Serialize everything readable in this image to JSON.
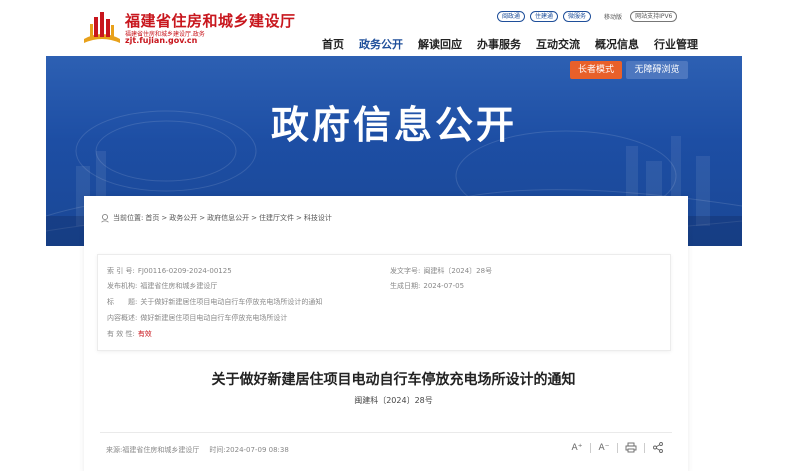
{
  "header": {
    "site_name": "福建省住房和城乡建设厅",
    "site_sub": "福建省住房和城乡建设厅.政务",
    "site_domain": "zjt.fujian.gov.cn",
    "top_links": [
      "闽政通",
      "住建通",
      "微服务"
    ],
    "mobile": "移动版",
    "ipv6": "网站支持IPV6"
  },
  "nav": {
    "items": [
      "首页",
      "政务公开",
      "解读回应",
      "办事服务",
      "互动交流",
      "概况信息",
      "行业管理"
    ],
    "active_index": 1
  },
  "banner": {
    "title": "政府信息公开",
    "elder_mode": "长者模式",
    "accessibility": "无障碍浏览"
  },
  "breadcrumb": {
    "label": "当前位置:",
    "items": [
      "首页",
      "政务公开",
      "政府信息公开",
      "住建厅文件",
      "科技设计"
    ]
  },
  "info": {
    "index_label": "索 引 号:",
    "index_value": "FJ00116-0209-2024-00125",
    "docno_label": "发文字号:",
    "docno_value": "闽建科〔2024〕28号",
    "org_label": "发布机构:",
    "org_value": "福建省住房和城乡建设厅",
    "date_label": "生成日期:",
    "date_value": "2024-07-05",
    "title_label": "标　　题:",
    "title_value": "关于做好新建居住项目电动自行车停放充电场所设计的通知",
    "summary_label": "内容概述:",
    "summary_value": "做好新建居住项目电动自行车停放充电场所设计",
    "validity_label": "有 效 性:",
    "validity_value": "有效"
  },
  "document": {
    "title": "关于做好新建居住项目电动自行车停放充电场所设计的通知",
    "number": "闽建科〔2024〕28号"
  },
  "meta": {
    "source": "来源:福建省住房和城乡建设厅",
    "time": "时间:2024-07-09 08:38"
  },
  "tools": {
    "font_larger": "A⁺",
    "font_smaller": "A⁻"
  },
  "colors": {
    "brand_red": "#c8161d",
    "brand_blue": "#1f4f9a",
    "elder_orange": "#e8602a"
  }
}
